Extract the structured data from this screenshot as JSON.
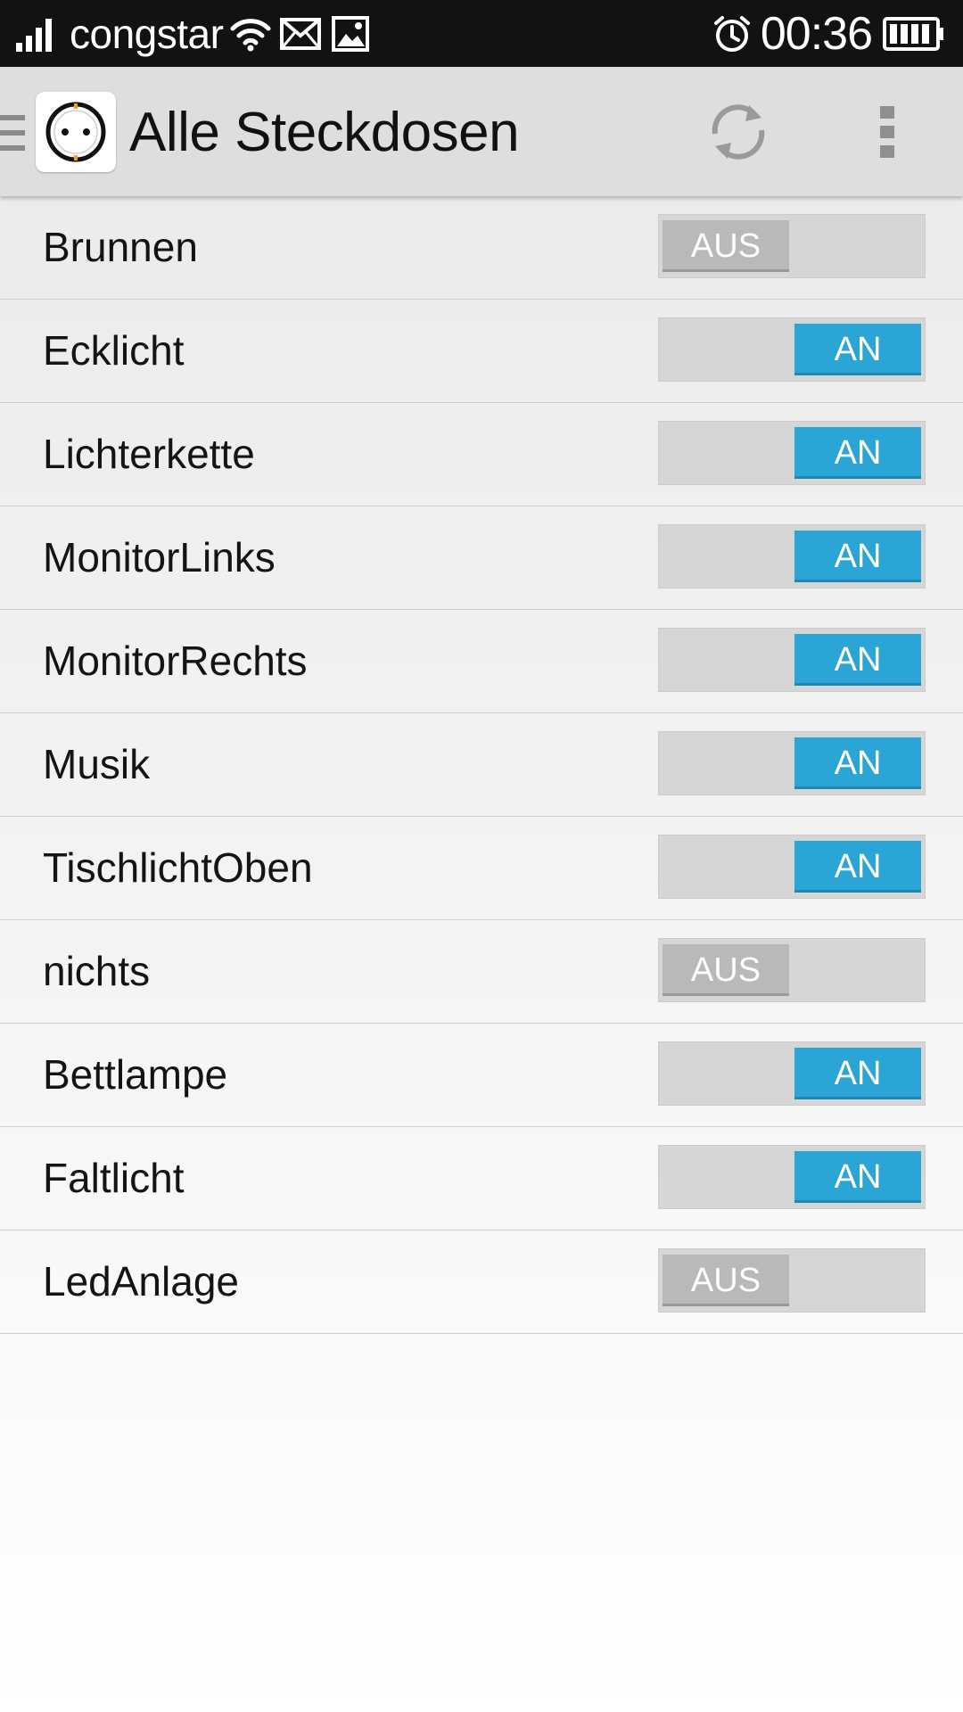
{
  "status_bar": {
    "carrier": "congstar",
    "time": "00:36",
    "icons": [
      "signal-icon",
      "wifi-icon",
      "mail-icon",
      "image-notification-icon",
      "alarm-icon",
      "battery-icon"
    ]
  },
  "action_bar": {
    "title": "Alle Steckdosen",
    "icons": {
      "drawer": "drawer-indicator-icon",
      "logo": "power-socket-icon",
      "refresh": "refresh-icon",
      "overflow": "overflow-menu-icon"
    }
  },
  "sockets": [
    {
      "name": "Brunnen",
      "state": "AUS",
      "on": false
    },
    {
      "name": "Ecklicht",
      "state": "AN",
      "on": true
    },
    {
      "name": "Lichterkette",
      "state": "AN",
      "on": true
    },
    {
      "name": "MonitorLinks",
      "state": "AN",
      "on": true
    },
    {
      "name": "MonitorRechts",
      "state": "AN",
      "on": true
    },
    {
      "name": "Musik",
      "state": "AN",
      "on": true
    },
    {
      "name": "TischlichtOben",
      "state": "AN",
      "on": true
    },
    {
      "name": "nichts",
      "state": "AUS",
      "on": false
    },
    {
      "name": "Bettlampe",
      "state": "AN",
      "on": true
    },
    {
      "name": "Faltlicht",
      "state": "AN",
      "on": true
    },
    {
      "name": "LedAnlage",
      "state": "AUS",
      "on": false
    }
  ],
  "colors": {
    "toggle_on": "#2aa5d6",
    "toggle_off": "#b9b9b9",
    "status_bar": "#121212",
    "action_bar": "#dedede"
  }
}
